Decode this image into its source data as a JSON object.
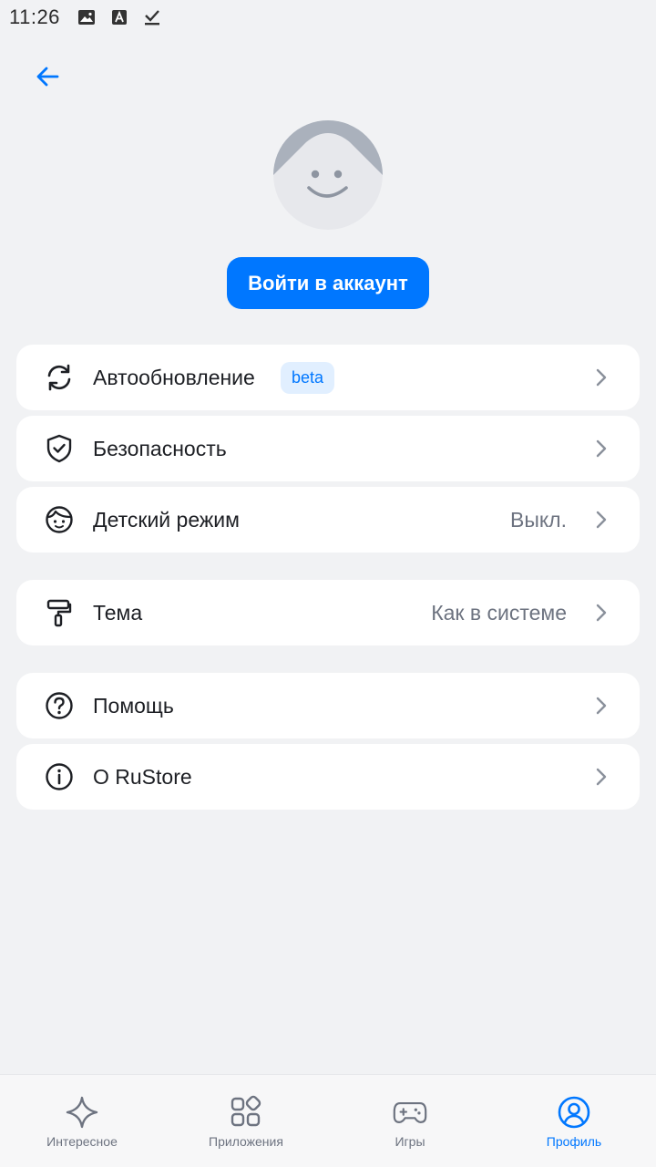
{
  "status_bar": {
    "time": "11:26",
    "icons": [
      "image-icon",
      "font-download-icon",
      "download-done-icon"
    ]
  },
  "header": {
    "back_icon": "arrow-left-icon"
  },
  "profile": {
    "avatar_icon": "default-avatar-icon",
    "login_label": "Войти в аккаунт"
  },
  "menu": {
    "autoupdate": {
      "icon": "refresh-icon",
      "label": "Автообновление",
      "badge": "beta"
    },
    "security": {
      "icon": "shield-check-icon",
      "label": "Безопасность"
    },
    "kids_mode": {
      "icon": "child-face-icon",
      "label": "Детский режим",
      "value": "Выкл."
    },
    "theme": {
      "icon": "paint-roller-icon",
      "label": "Тема",
      "value": "Как в системе"
    },
    "help": {
      "icon": "question-circle-icon",
      "label": "Помощь"
    },
    "about": {
      "icon": "info-circle-icon",
      "label": "О RuStore"
    }
  },
  "bottom_nav": {
    "items": [
      {
        "label": "Интересное",
        "icon": "sparkle-icon",
        "active": false
      },
      {
        "label": "Приложения",
        "icon": "apps-grid-icon",
        "active": false
      },
      {
        "label": "Игры",
        "icon": "gamepad-icon",
        "active": false
      },
      {
        "label": "Профиль",
        "icon": "profile-icon",
        "active": true
      }
    ]
  },
  "colors": {
    "accent": "#0077ff",
    "background": "#f1f2f4",
    "card": "#ffffff",
    "secondary_text": "#6d7380"
  }
}
